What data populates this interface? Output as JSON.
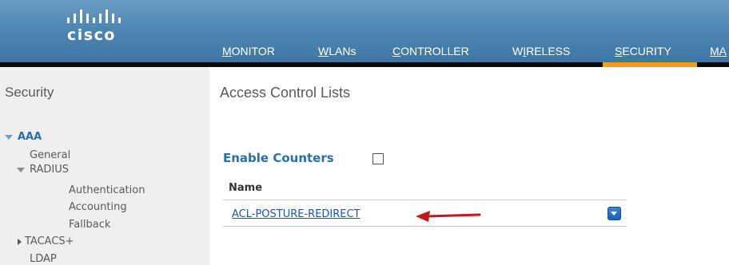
{
  "brand": {
    "logo_text": "cisco"
  },
  "nav": {
    "items": [
      {
        "label": "MONITOR",
        "access_key": "M"
      },
      {
        "label": "WLANs",
        "access_key": "W"
      },
      {
        "label": "CONTROLLER",
        "access_key": "C"
      },
      {
        "label": "WIRELESS",
        "access_key": "I"
      },
      {
        "label": "SECURITY",
        "access_key": "S",
        "active": true
      },
      {
        "label": "MA",
        "access_key": "M"
      }
    ]
  },
  "sidebar": {
    "title": "Security",
    "aaa_label": "AAA",
    "general": "General",
    "radius": "RADIUS",
    "authentication": "Authentication",
    "accounting": "Accounting",
    "fallback": "Fallback",
    "tacacs": "TACACS+",
    "ldap": "LDAP"
  },
  "main": {
    "title": "Access Control Lists",
    "enable_counters_label": "Enable Counters",
    "enable_counters_checked": false,
    "column_name": "Name",
    "acl_rows": [
      {
        "name": "ACL-POSTURE-REDIRECT"
      }
    ]
  },
  "colors": {
    "header_blue": "#4f87b3",
    "active_tab": "#f39a1f",
    "link_blue": "#1a55b0",
    "sidebar_bg": "#efefef",
    "annotation_arrow": "#c0191f"
  }
}
